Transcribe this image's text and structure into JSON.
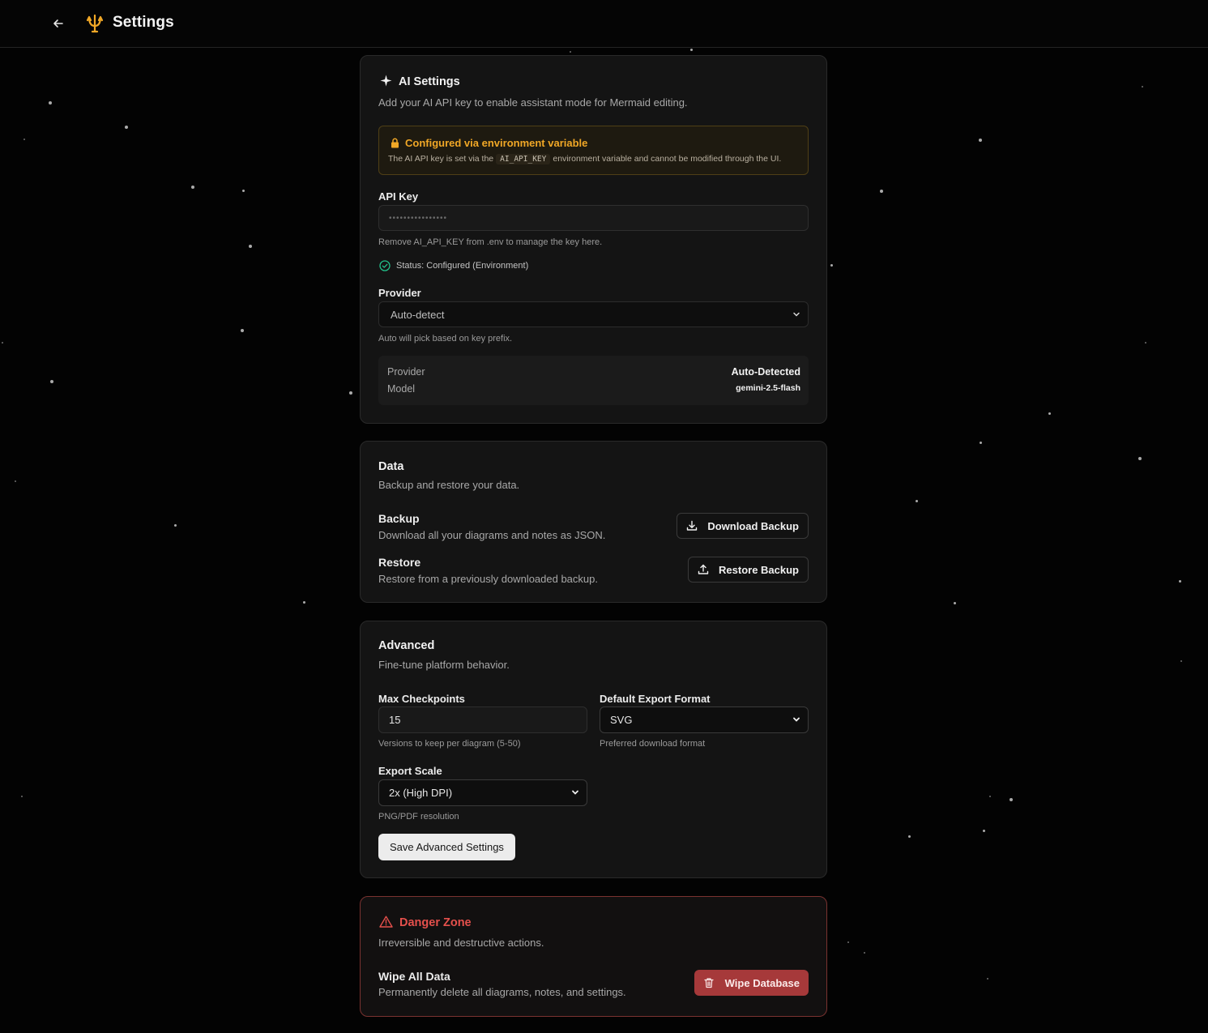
{
  "header": {
    "title": "Settings",
    "back_icon": "arrow-left-icon",
    "logo_icon": "trident-logo-icon",
    "accent": "#f0a726"
  },
  "ai_settings": {
    "title": "AI Settings",
    "icon": "sparkle-icon",
    "description": "Add your AI API key to enable assistant mode for Mermaid editing.",
    "env_notice": {
      "icon": "lock-icon",
      "title": "Configured via environment variable",
      "text_before": "The AI API key is set via the",
      "code": "AI_API_KEY",
      "text_after": "environment variable and cannot be modified through the UI."
    },
    "api_key": {
      "label": "API Key",
      "value": "••••••••••••••••",
      "hint": "Remove AI_API_KEY from .env to manage the key here."
    },
    "status": {
      "icon": "check-circle-icon",
      "text": "Status: Configured (Environment)",
      "color": "#22c08a"
    },
    "provider": {
      "label": "Provider",
      "selected": "Auto-detect",
      "hint": "Auto will pick based on key prefix."
    },
    "summary": {
      "provider_label": "Provider",
      "provider_value": "Auto-Detected",
      "model_label": "Model",
      "model_value": "gemini-2.5-flash"
    }
  },
  "data_section": {
    "title": "Data",
    "description": "Backup and restore your data.",
    "backup": {
      "title": "Backup",
      "description": "Download all your diagrams and notes as JSON.",
      "button": "Download Backup",
      "icon": "download-icon"
    },
    "restore": {
      "title": "Restore",
      "description": "Restore from a previously downloaded backup.",
      "button": "Restore Backup",
      "icon": "upload-icon"
    }
  },
  "advanced": {
    "title": "Advanced",
    "description": "Fine-tune platform behavior.",
    "max_checkpoints": {
      "label": "Max Checkpoints",
      "value": "15",
      "hint": "Versions to keep per diagram (5-50)"
    },
    "export_format": {
      "label": "Default Export Format",
      "selected": "SVG",
      "hint": "Preferred download format"
    },
    "export_scale": {
      "label": "Export Scale",
      "selected": "2x (High DPI)",
      "hint": "PNG/PDF resolution"
    },
    "save_button": "Save Advanced Settings"
  },
  "danger_zone": {
    "title": "Danger Zone",
    "icon": "warning-triangle-icon",
    "description": "Irreversible and destructive actions.",
    "wipe": {
      "title": "Wipe All Data",
      "description": "Permanently delete all diagrams, notes, and settings.",
      "button": "Wipe Database",
      "icon": "trash-icon",
      "color": "#a6393a"
    }
  }
}
